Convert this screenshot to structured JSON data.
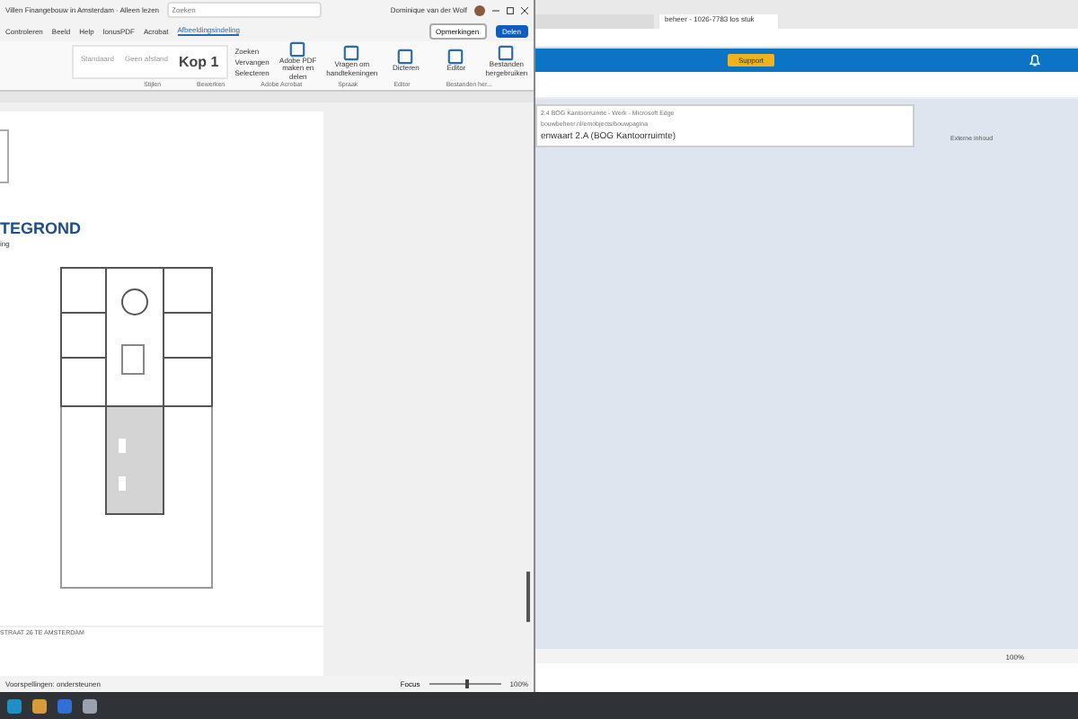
{
  "word": {
    "title": "Villen Finangebouw in Amsterdam · Alleen lezen",
    "search": {
      "placeholder": "Zoeken"
    },
    "user": "Dominique van der Wolf",
    "menu": [
      {
        "label": "Controleren",
        "selected": false
      },
      {
        "label": "Beeld",
        "selected": false
      },
      {
        "label": "Help",
        "selected": false
      },
      {
        "label": "lonusPDF",
        "selected": false
      },
      {
        "label": "Acrobat",
        "selected": false
      },
      {
        "label": "Afbeeldingsindeling",
        "selected": true
      }
    ],
    "comments_button": "Opmerkingen",
    "share_button": "Delen",
    "styles": [
      {
        "label": "Standaard"
      },
      {
        "label": "Geen afstand"
      },
      {
        "label": "Kop 1"
      }
    ],
    "edit_items": [
      "Zoeken",
      "Vervangen",
      "Selecteren"
    ],
    "tools": [
      {
        "label": "Adobe PDF maken en delen"
      },
      {
        "label": "Vragen om handtekeningen"
      },
      {
        "label": "Dicteren"
      },
      {
        "label": "Editor"
      },
      {
        "label": "Bestanden hergebruiken"
      }
    ],
    "groups": [
      "Stijlen",
      "Bewerken",
      "Adobe Acrobat",
      "Spraak",
      "Editor",
      "Bestanden her..."
    ],
    "page": {
      "heading": "TEGROND",
      "subheading": "ing",
      "footer": "STRAAT 26 TE AMSTERDAM"
    },
    "status": {
      "left": "Voorspellingen: ondersteunen",
      "focus": "Focus",
      "zoom": "100%",
      "level": 0.5
    }
  },
  "browser": {
    "tabs": [
      {
        "selected": false
      },
      {
        "label": "beheer - 1026-7783 los stuk",
        "selected": true
      }
    ],
    "support_button": "Support",
    "popup": {
      "title": "2.4 BOG Kantoorruimte - Werk - Microsoft Edge",
      "url": "bouwbeheer.nl/emobjects/bouwpagina",
      "heading": "enwaart 2.A (BOG Kantoorruimte)"
    },
    "side_label": "Externe inhoud",
    "zoom": "100%"
  }
}
